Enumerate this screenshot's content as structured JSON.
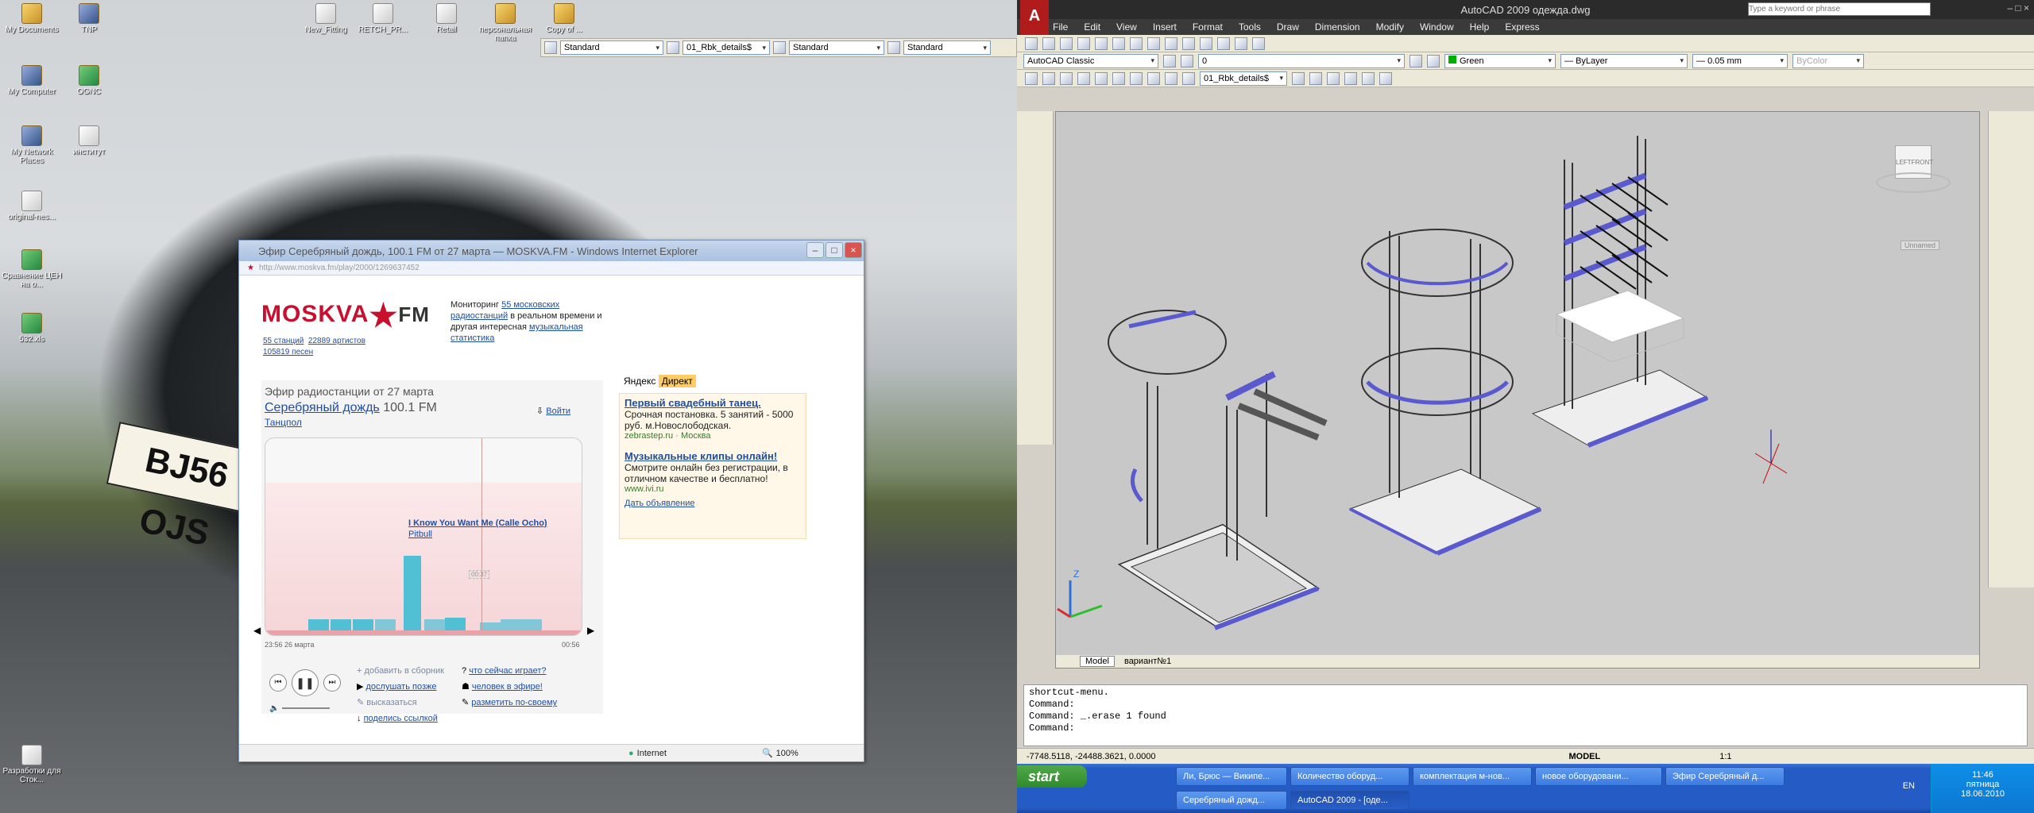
{
  "left_desktop": {
    "icons": [
      {
        "label": "My Documents"
      },
      {
        "label": "TNP"
      },
      {
        "label": "My Computer"
      },
      {
        "label": "OGNC"
      },
      {
        "label": "My Network Places"
      },
      {
        "label": "институт"
      },
      {
        "label": "original-nes..."
      },
      {
        "label": "Сравнение ЦЕН на о..."
      },
      {
        "label": "532.xls"
      },
      {
        "label": "Разработки для Сток..."
      },
      {
        "label": "New_Fitting"
      },
      {
        "label": "RETCH_PR..."
      },
      {
        "label": "Retail"
      },
      {
        "label": "персональная папка"
      },
      {
        "label": "Copy of ... "
      }
    ],
    "plate_text": "BJ56 OJS",
    "acad_float_toolbar": {
      "combos": [
        "Standard",
        "01_Rbk_details$",
        "Standard",
        "Standard"
      ]
    }
  },
  "ie": {
    "title": "Эфир Серебряный дождь, 100.1 FM от 27 марта — MOSKVA.FM - Windows Internet Explorer",
    "address": "http://www.moskva.fm/play/2000/1269637452",
    "logo_main": "MOSKVA",
    "logo_fm": "FM",
    "stats": {
      "stations": "55 станций",
      "artists": "22889 артистов",
      "songs": "105819 песен"
    },
    "monitoring": {
      "pre": "Мониторинг",
      "link1": "55 московских радиостанций",
      "mid": "в реальном времени и другая интересная",
      "link2": "музыкальная статистика"
    },
    "player": {
      "heading": "Эфир радиостанции от 27 марта",
      "station": "Серебряный дождь",
      "freq": "100.1 FM",
      "genre": "Танцпол",
      "login": "Войти",
      "track": "I Know You Want Me (Calle Ocho)",
      "artist": "Pitbull",
      "time_marker": "00:37",
      "time_start": "23:56 26 марта",
      "time_end": "00:56",
      "actions_left": [
        "добавить в сборник",
        "дослушать позже",
        "высказаться",
        "поделись ссылкой"
      ],
      "actions_right": [
        "что сейчас играет?",
        "человек в эфире!",
        "разметить по-своему"
      ]
    },
    "ads": {
      "brand1": "Яндекс",
      "brand2": "Директ",
      "items": [
        {
          "title": "Первый свадебный танец.",
          "text": "Срочная постановка. 5 занятий - 5000 руб. м.Новослободская.",
          "url": "zebrastep.ru",
          "loc": "Москва"
        },
        {
          "title": "Музыкальные клипы онлайн!",
          "text": "Смотрите онлайн без регистрации, в отличном качестве и бесплатно!",
          "url": "www.ivi.ru"
        }
      ],
      "place": "Дать объявление"
    },
    "status": {
      "zone": "Internet",
      "zoom": "100%"
    }
  },
  "acad": {
    "title": "AutoCAD 2009  одежда.dwg",
    "search_placeholder": "Type a keyword or phrase",
    "menu": [
      "File",
      "Edit",
      "View",
      "Insert",
      "Format",
      "Tools",
      "Draw",
      "Dimension",
      "Modify",
      "Window",
      "Help",
      "Express"
    ],
    "workspace": "AutoCAD Classic",
    "layer": "0",
    "color": "Green",
    "linetype": "ByLayer",
    "lineweight": "0.05 mm",
    "plotstyle": "ByColor",
    "dimstyle": "01_Rbk_details$",
    "viewcube": {
      "left": "LEFT",
      "front": "FRONT",
      "unnamed": "Unnamed"
    },
    "tabs": [
      "Model",
      "вариант№1"
    ],
    "cmd_lines": [
      "shortcut-menu.",
      "Command:",
      "Command: _.erase 1 found",
      "",
      "Command:"
    ],
    "coords": "-7748.5118, -24488.3621, 0.0000",
    "status_mode": "MODEL",
    "scale": "1:1"
  },
  "taskbar": {
    "start": "start",
    "buttons_row1": [
      "Ли, Брюс — Википе...",
      "Количество оборуд...",
      "комплектация м-нов...",
      "новое оборудовани...",
      "Эфир Серебряный д..."
    ],
    "buttons_row2": [
      "Серебряный дожд...",
      "AutoCAD 2009 - [оде..."
    ],
    "lang": "EN",
    "time": "11:46",
    "day": "пятница",
    "date": "18.06.2010"
  }
}
